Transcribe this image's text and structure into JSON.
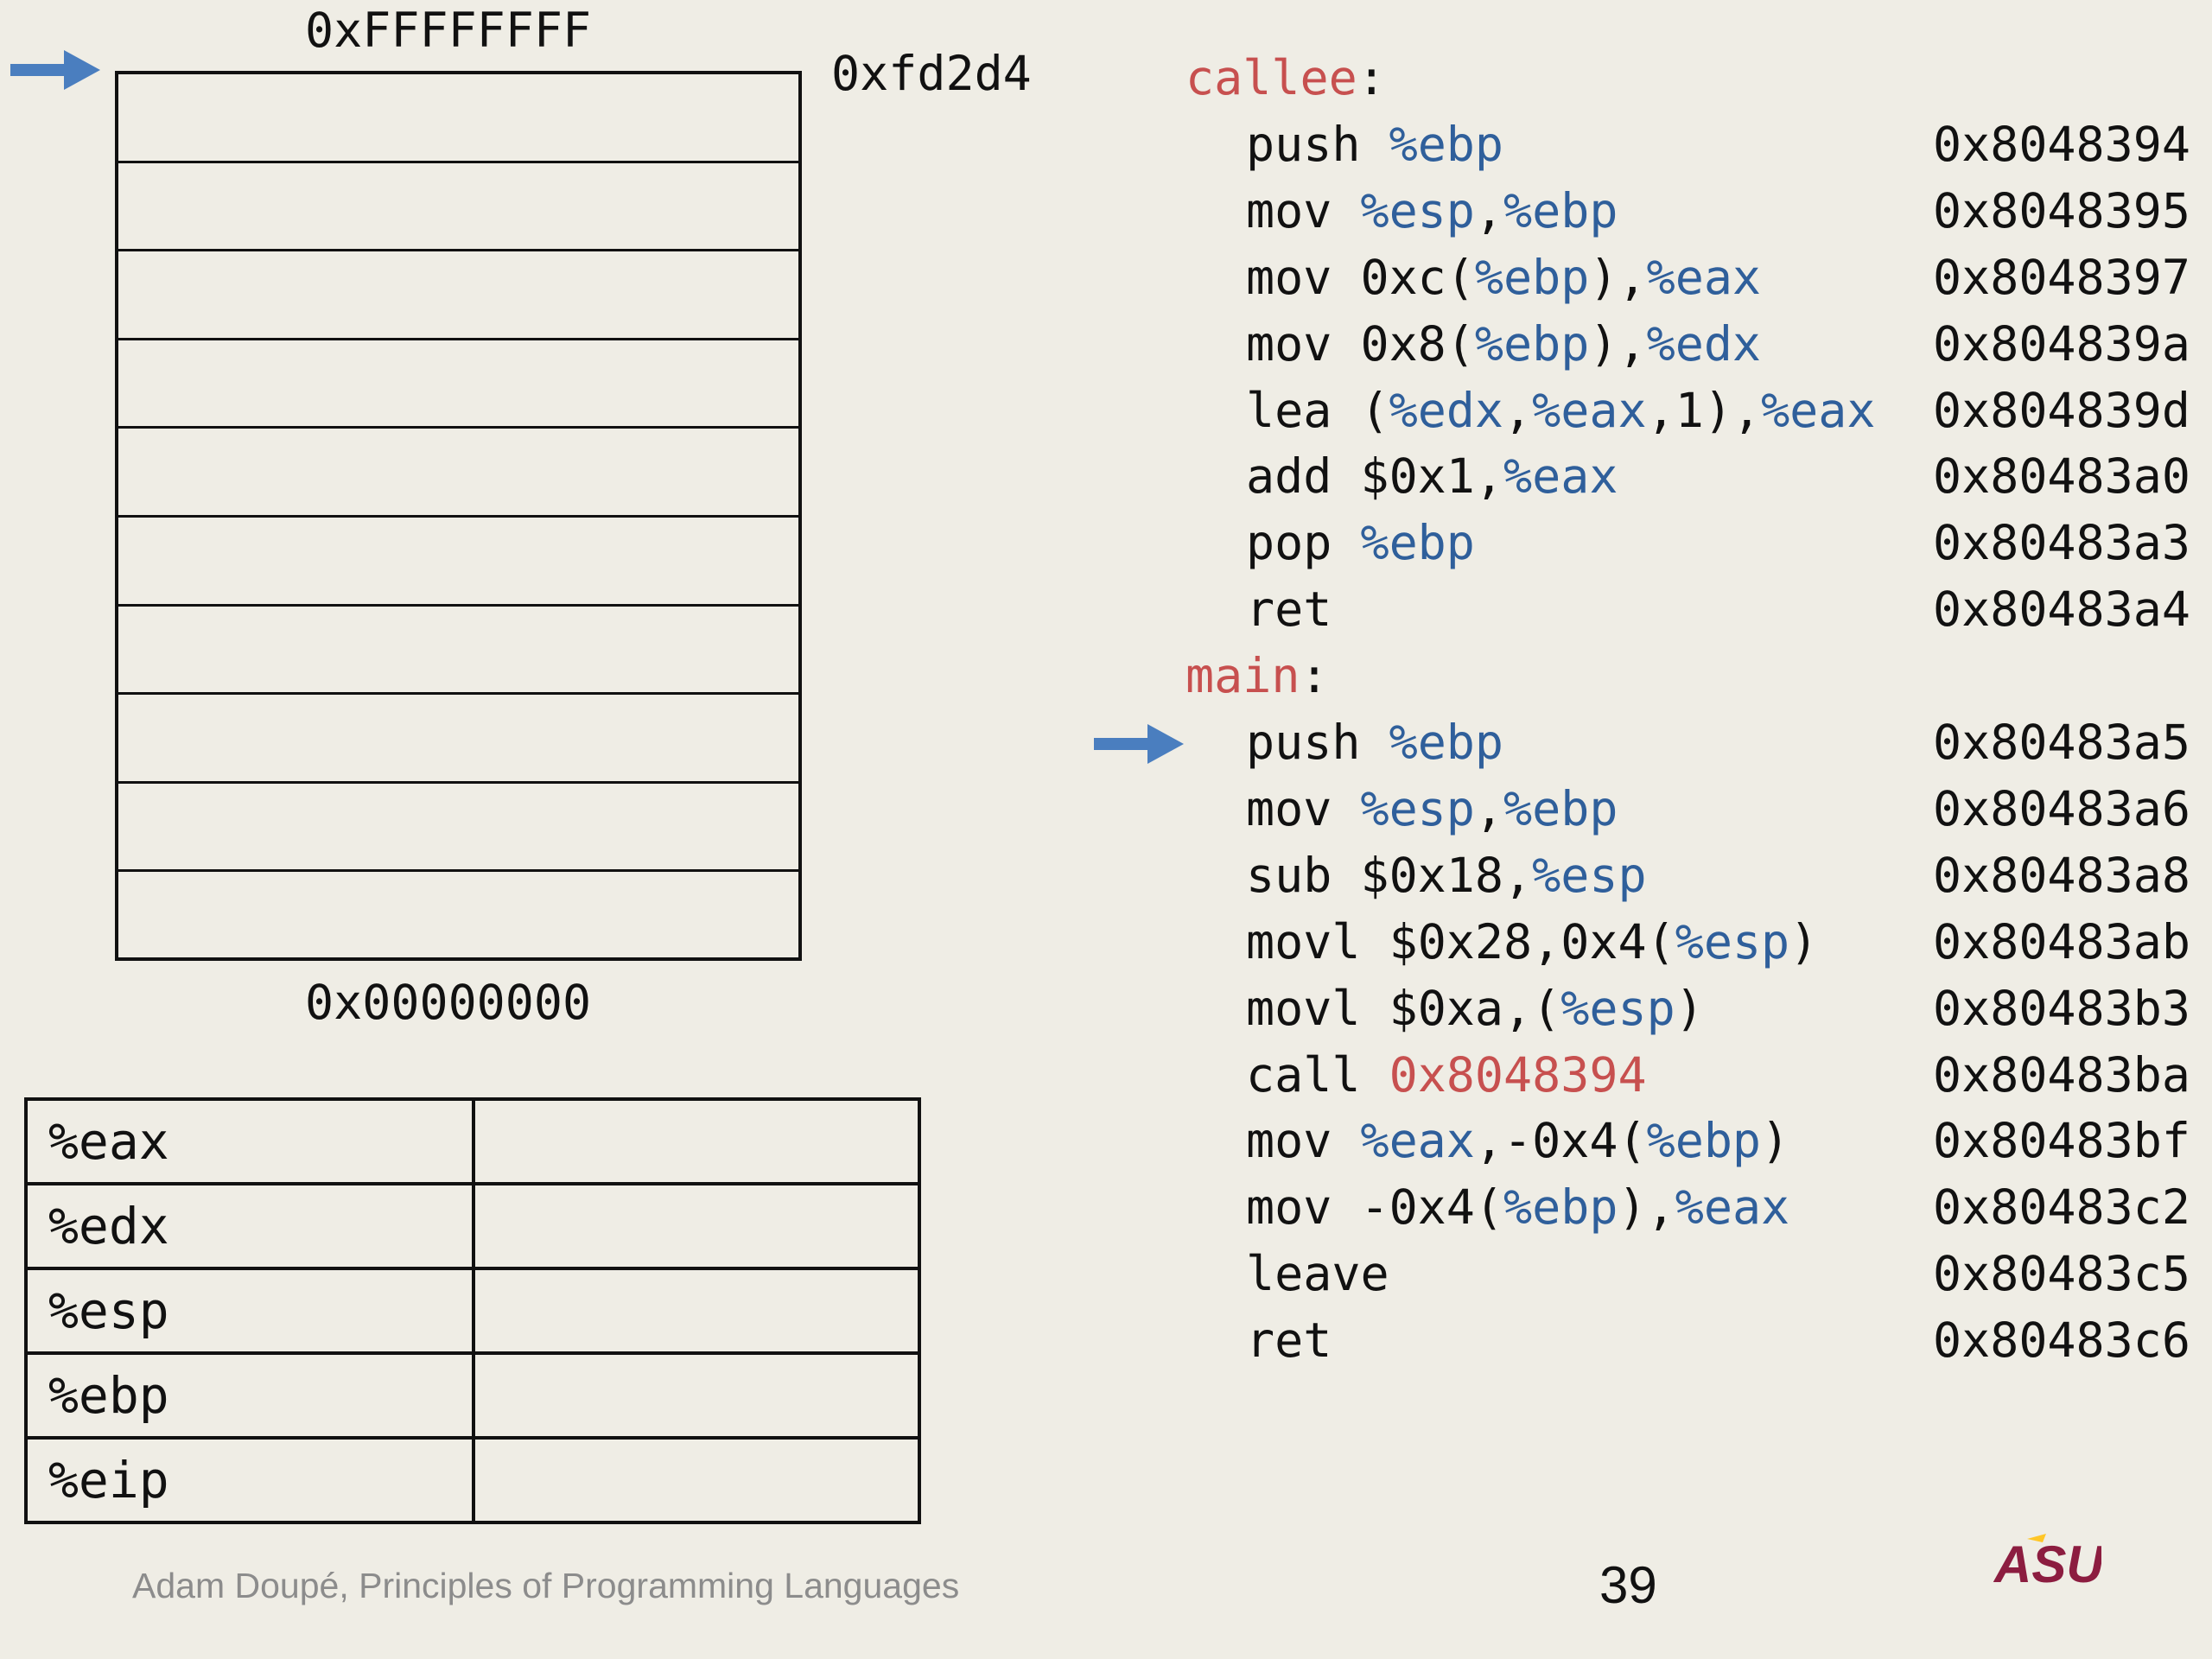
{
  "stack": {
    "top_label": "0xFFFFFFFF",
    "bottom_label": "0x00000000",
    "pointer_label": "0xfd2d4",
    "cells": [
      "",
      "",
      "",
      "",
      "",
      "",
      "",
      "",
      "",
      ""
    ]
  },
  "registers": [
    {
      "name": "%eax",
      "value": ""
    },
    {
      "name": "%edx",
      "value": ""
    },
    {
      "name": "%esp",
      "value": ""
    },
    {
      "name": "%ebp",
      "value": ""
    },
    {
      "name": "%eip",
      "value": ""
    }
  ],
  "code": {
    "callee_label": "callee",
    "main_label": "main",
    "colon": ":",
    "callee": [
      {
        "op": "push ",
        "args": [
          {
            "t": "%ebp",
            "c": "blue"
          }
        ],
        "addr": "0x8048394"
      },
      {
        "op": "mov ",
        "args": [
          {
            "t": "%esp",
            "c": "blue"
          },
          {
            "t": ",",
            "c": ""
          },
          {
            "t": "%ebp",
            "c": "blue"
          }
        ],
        "addr": "0x8048395"
      },
      {
        "op": "mov ",
        "args": [
          {
            "t": "0xc(",
            "c": ""
          },
          {
            "t": "%ebp",
            "c": "blue"
          },
          {
            "t": "),",
            "c": ""
          },
          {
            "t": "%eax",
            "c": "blue"
          }
        ],
        "addr": "0x8048397"
      },
      {
        "op": "mov ",
        "args": [
          {
            "t": "0x8(",
            "c": ""
          },
          {
            "t": "%ebp",
            "c": "blue"
          },
          {
            "t": "),",
            "c": ""
          },
          {
            "t": "%edx",
            "c": "blue"
          }
        ],
        "addr": "0x804839a"
      },
      {
        "op": "lea ",
        "args": [
          {
            "t": "(",
            "c": ""
          },
          {
            "t": "%edx",
            "c": "blue"
          },
          {
            "t": ",",
            "c": ""
          },
          {
            "t": "%eax",
            "c": "blue"
          },
          {
            "t": ",1),",
            "c": ""
          },
          {
            "t": "%eax",
            "c": "blue"
          }
        ],
        "addr": "0x804839d"
      },
      {
        "op": "add ",
        "args": [
          {
            "t": "$0x1,",
            "c": ""
          },
          {
            "t": "%eax",
            "c": "blue"
          }
        ],
        "addr": "0x80483a0"
      },
      {
        "op": "pop ",
        "args": [
          {
            "t": "%ebp",
            "c": "blue"
          }
        ],
        "addr": "0x80483a3"
      },
      {
        "op": "ret",
        "args": [],
        "addr": "0x80483a4"
      }
    ],
    "main": [
      {
        "op": "push ",
        "args": [
          {
            "t": "%ebp",
            "c": "blue"
          }
        ],
        "addr": "0x80483a5"
      },
      {
        "op": "mov ",
        "args": [
          {
            "t": "%esp",
            "c": "blue"
          },
          {
            "t": ",",
            "c": ""
          },
          {
            "t": "%ebp",
            "c": "blue"
          }
        ],
        "addr": "0x80483a6"
      },
      {
        "op": "sub ",
        "args": [
          {
            "t": "$0x18,",
            "c": ""
          },
          {
            "t": "%esp",
            "c": "blue"
          }
        ],
        "addr": "0x80483a8"
      },
      {
        "op": "movl ",
        "args": [
          {
            "t": "$0x28,0x4(",
            "c": ""
          },
          {
            "t": "%esp",
            "c": "blue"
          },
          {
            "t": ")",
            "c": ""
          }
        ],
        "addr": "0x80483ab"
      },
      {
        "op": "movl ",
        "args": [
          {
            "t": "$0xa,(",
            "c": ""
          },
          {
            "t": "%esp",
            "c": "blue"
          },
          {
            "t": ")",
            "c": ""
          }
        ],
        "addr": "0x80483b3"
      },
      {
        "op": "call ",
        "args": [
          {
            "t": "0x8048394",
            "c": "red"
          }
        ],
        "addr": "0x80483ba"
      },
      {
        "op": "mov ",
        "args": [
          {
            "t": "%eax",
            "c": "blue"
          },
          {
            "t": ",-0x4(",
            "c": ""
          },
          {
            "t": "%ebp",
            "c": "blue"
          },
          {
            "t": ")",
            "c": ""
          }
        ],
        "addr": "0x80483bf"
      },
      {
        "op": "mov ",
        "args": [
          {
            "t": "-0x4(",
            "c": ""
          },
          {
            "t": "%ebp",
            "c": "blue"
          },
          {
            "t": "),",
            "c": ""
          },
          {
            "t": "%eax",
            "c": "blue"
          }
        ],
        "addr": "0x80483c2"
      },
      {
        "op": "leave",
        "args": [],
        "addr": "0x80483c5"
      },
      {
        "op": "ret",
        "args": [],
        "addr": "0x80483c6"
      }
    ]
  },
  "footer": {
    "credit": "Adam Doupé, Principles of Programming Languages",
    "page_number": "39",
    "logo_text": "ASU"
  },
  "colors": {
    "arrow": "#4a7ebf",
    "register_blue": "#2f5f9b",
    "label_red": "#c7504f",
    "logo_red": "#8c1d40",
    "logo_gold": "#ffc627"
  },
  "icons": [
    "stack-pointer-arrow-icon",
    "instruction-pointer-arrow-icon",
    "asu-logo"
  ]
}
